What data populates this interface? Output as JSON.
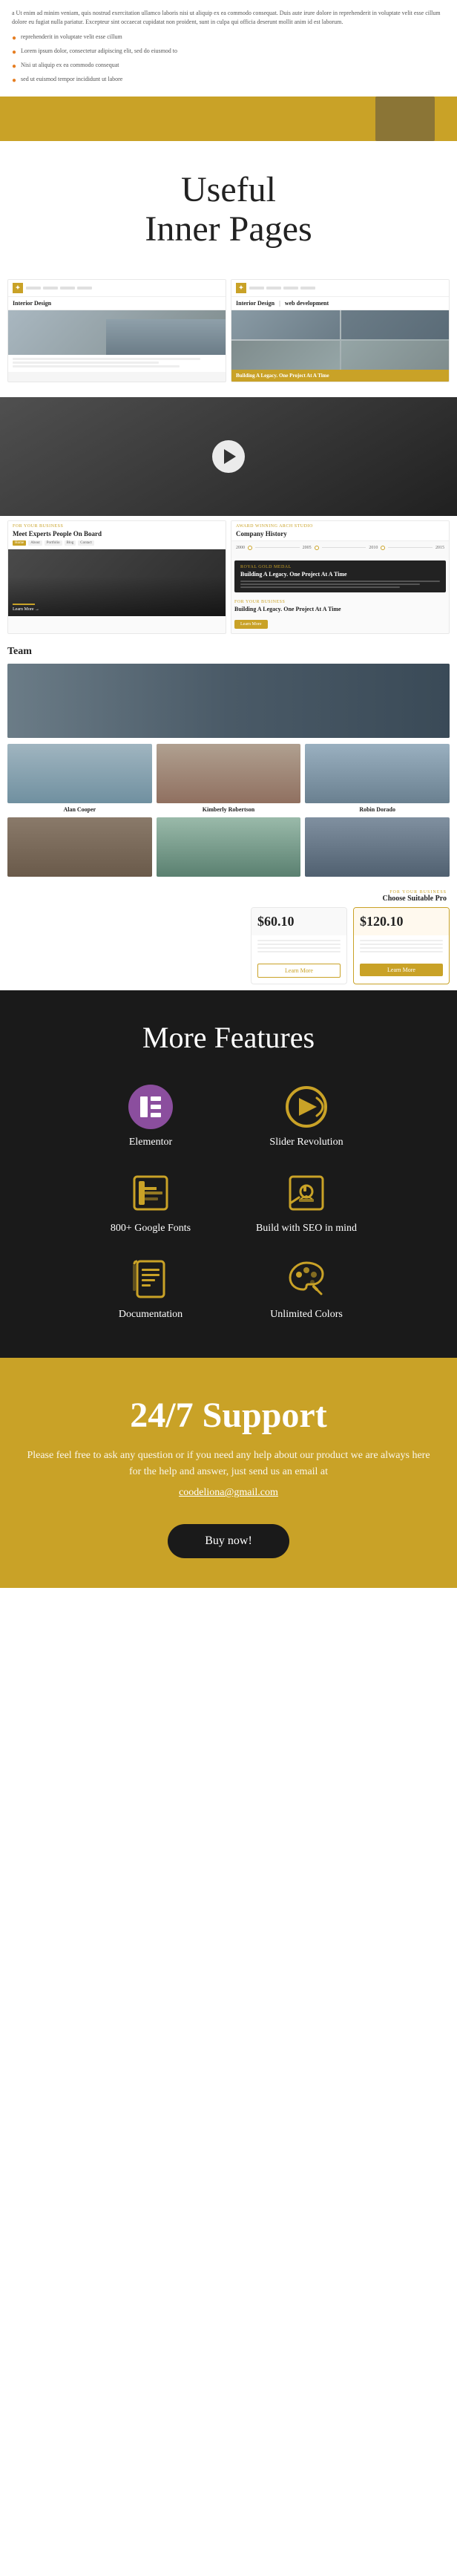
{
  "top": {
    "lorem_text": "a Ut enim ad minim veniam, quis nostrud exercitation ullamco laboris nisi ut aliquip ex ea commodo consequat. Duis aute irure dolore in reprehenderit in voluptate velit esse cillum dolore eu fugiat nulla pariatur. Excepteur sint occaecat cupidatat non proident, sunt in culpa qui officia deserunt mollit anim id est laborum.",
    "check_items": [
      "reprehenderit in voluptate velit esse cillum",
      "Lorem ipsum dolor, consectetur adipiscing elit, sed do eiusmod to",
      "Nisi ut aliquip ex ea commodo consequat",
      "sed ut euismod tempor incididunt ut labore"
    ]
  },
  "inner_pages": {
    "title_line1": "Useful",
    "title_line2": "Inner Pages"
  },
  "thumbnails": {
    "card1": {
      "label": "Interior Design"
    },
    "card2": {
      "label": "Interior Design"
    },
    "card3": {
      "label": "web development"
    },
    "caption": "Building A Legacy. One Project At A Time"
  },
  "meet_section": {
    "subtitle": "FOR YOUR BUSINESS",
    "title": "Meet Experts People On Board"
  },
  "history_section": {
    "subtitle": "AWARD WINNING ARCH STUDIO",
    "title": "Company History",
    "years": [
      "2000",
      "2005",
      "2010",
      "2015"
    ],
    "medal_badge": "ROYAL GOLD MEDAL",
    "medal_title": "Building A Legacy. One Project At A Time"
  },
  "team_section": {
    "title": "Team",
    "members": [
      {
        "name": "Alan Cooper",
        "role": ""
      },
      {
        "name": "Kimberly Robertson",
        "role": ""
      },
      {
        "name": "Robin Dorado",
        "role": ""
      }
    ]
  },
  "pricing_section": {
    "subtitle": "FOR YOUR BUSINESS",
    "title": "Choose Suitable Pro",
    "plans": [
      {
        "price": "$60.10",
        "btn_label": "Learn More",
        "btn_style": "outline"
      },
      {
        "price": "$120.10",
        "btn_label": "Learn More",
        "btn_style": "filled"
      }
    ]
  },
  "more_features": {
    "title": "More Features",
    "features": [
      {
        "id": "elementor",
        "label": "Elementor",
        "icon_type": "elementor"
      },
      {
        "id": "slider-revolution",
        "label": "Slider Revolution",
        "icon_type": "slider"
      },
      {
        "id": "google-fonts",
        "label": "800+ Google Fonts",
        "icon_type": "fonts"
      },
      {
        "id": "seo",
        "label": "Build with SEO in mind",
        "icon_type": "seo"
      },
      {
        "id": "documentation",
        "label": "Documentation",
        "icon_type": "docs"
      },
      {
        "id": "unlimited-colors",
        "label": "Unlimited Colors",
        "icon_type": "colors"
      }
    ]
  },
  "support_section": {
    "title": "24/7 Support",
    "description": "Please feel free to ask any question or if you need any help about our product we are always here for the help and answer, just send us  an email at",
    "email": "coodeliona@gmail.com",
    "buy_button": "Buy now!"
  }
}
